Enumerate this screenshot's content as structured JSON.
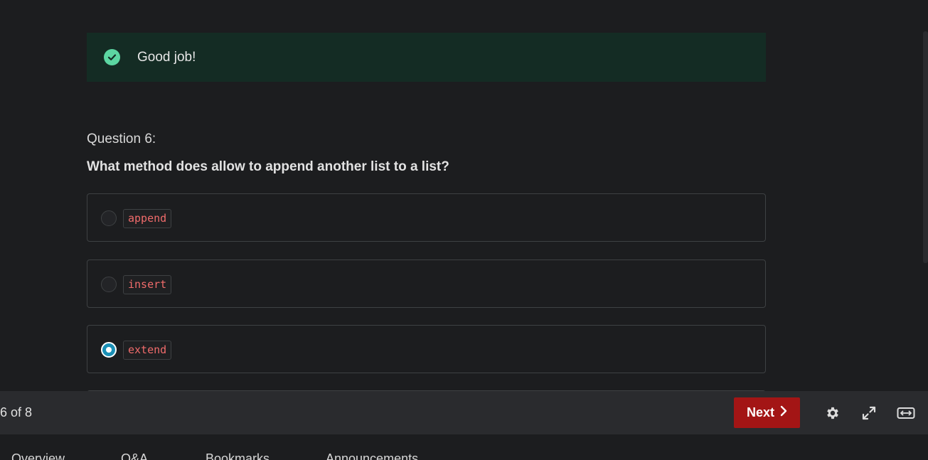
{
  "feedback": {
    "message": "Good job!",
    "icon": "check-circle-icon",
    "color": "#5cd6a2"
  },
  "question": {
    "number_label": "Question 6:",
    "text": "What method does allow to append another list to a list?"
  },
  "options": [
    {
      "label": "append",
      "selected": false
    },
    {
      "label": "insert",
      "selected": false
    },
    {
      "label": "extend",
      "selected": true
    }
  ],
  "footer": {
    "progress": "6 of 8",
    "next_label": "Next",
    "next_color": "#a31515",
    "icons": [
      "gear-icon",
      "expand-icon",
      "theater-mode-icon"
    ]
  },
  "tabs": [
    "Overview",
    "Q&A",
    "Bookmarks",
    "Announcements"
  ]
}
